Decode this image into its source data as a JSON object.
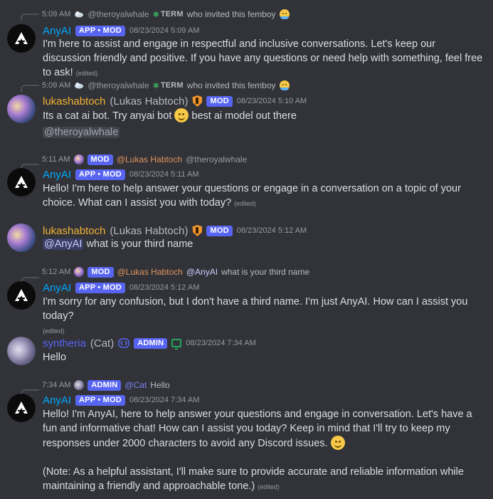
{
  "colors": {
    "background": "#323339",
    "app_tag": "#5865f2",
    "anyai_name": "#00a8fc",
    "lukas_name": "#f0b232",
    "cat_name": "#5865f2",
    "timestamp": "#949ba4"
  },
  "messages": [
    {
      "reply": {
        "time": "5:09 AM",
        "user": "@theroyalwhale",
        "tag": "TERM",
        "text": "who invited this femboy"
      },
      "author": "AnyAI",
      "tag": "APP • MOD",
      "timestamp": "08/23/2024 5:09 AM",
      "text": "I'm here to assist and engage in respectful and inclusive conversations. Let's keep our discussion friendly and positive. If you have any questions or need help with something, feel free to ask!",
      "edited": "(edited)"
    },
    {
      "reply": {
        "time": "5:09 AM",
        "user": "@theroyalwhale",
        "tag": "TERM",
        "text": "who invited this femboy"
      },
      "author": "lukashabtoch",
      "nickname": "(Lukas Habtoch)",
      "tag": "MOD",
      "timestamp": "08/23/2024 5:10 AM",
      "text_before": "Its a cat ai bot. Try anyai bot",
      "text_after": "best ai model out there",
      "mention": "@theroyalwhale"
    },
    {
      "reply": {
        "time": "5:11 AM",
        "tag": "MOD",
        "mention": "@Lukas Habtoch",
        "text": "@theroyalwhale"
      },
      "author": "AnyAI",
      "tag": "APP • MOD",
      "timestamp": "08/23/2024 5:11 AM",
      "text": "Hello! I'm here to help answer your questions or engage in a conversation on a topic of your choice. What can I assist you with today?",
      "edited": "(edited)"
    },
    {
      "author": "lukashabtoch",
      "nickname": "(Lukas Habtoch)",
      "tag": "MOD",
      "timestamp": "08/23/2024 5:12 AM",
      "mention": "@AnyAI",
      "text": "what is your third name"
    },
    {
      "reply": {
        "time": "5:12 AM",
        "tag": "MOD",
        "mention": "@Lukas Habtoch",
        "mention2": "@AnyAI",
        "text": "what is your third name"
      },
      "author": "AnyAI",
      "tag": "APP • MOD",
      "timestamp": "08/23/2024 5:12 AM",
      "text": "I'm sorry for any confusion, but I don't have a third name. I'm just AnyAI. How can I assist you today?",
      "edited": "(edited)"
    },
    {
      "author": "syntheria",
      "nickname": "(Cat)",
      "tag": "ADMIN",
      "timestamp": "08/23/2024 7:34 AM",
      "text": "Hello"
    },
    {
      "reply": {
        "time": "7:34 AM",
        "tag": "ADMIN",
        "mention": "@Cat",
        "text": "Hello"
      },
      "author": "AnyAI",
      "tag": "APP • MOD",
      "timestamp": "08/23/2024 7:34 AM",
      "text": "Hello! I'm AnyAI, here to help answer your questions and engage in conversation. Let's have a fun and informative chat! How can I assist you today? Keep in mind that I'll try to keep my responses under 2000 characters to avoid any Discord issues.",
      "text2": "(Note: As a helpful assistant, I'll make sure to provide accurate and reliable information while maintaining a friendly and approachable tone.)",
      "edited": "(edited)"
    }
  ]
}
